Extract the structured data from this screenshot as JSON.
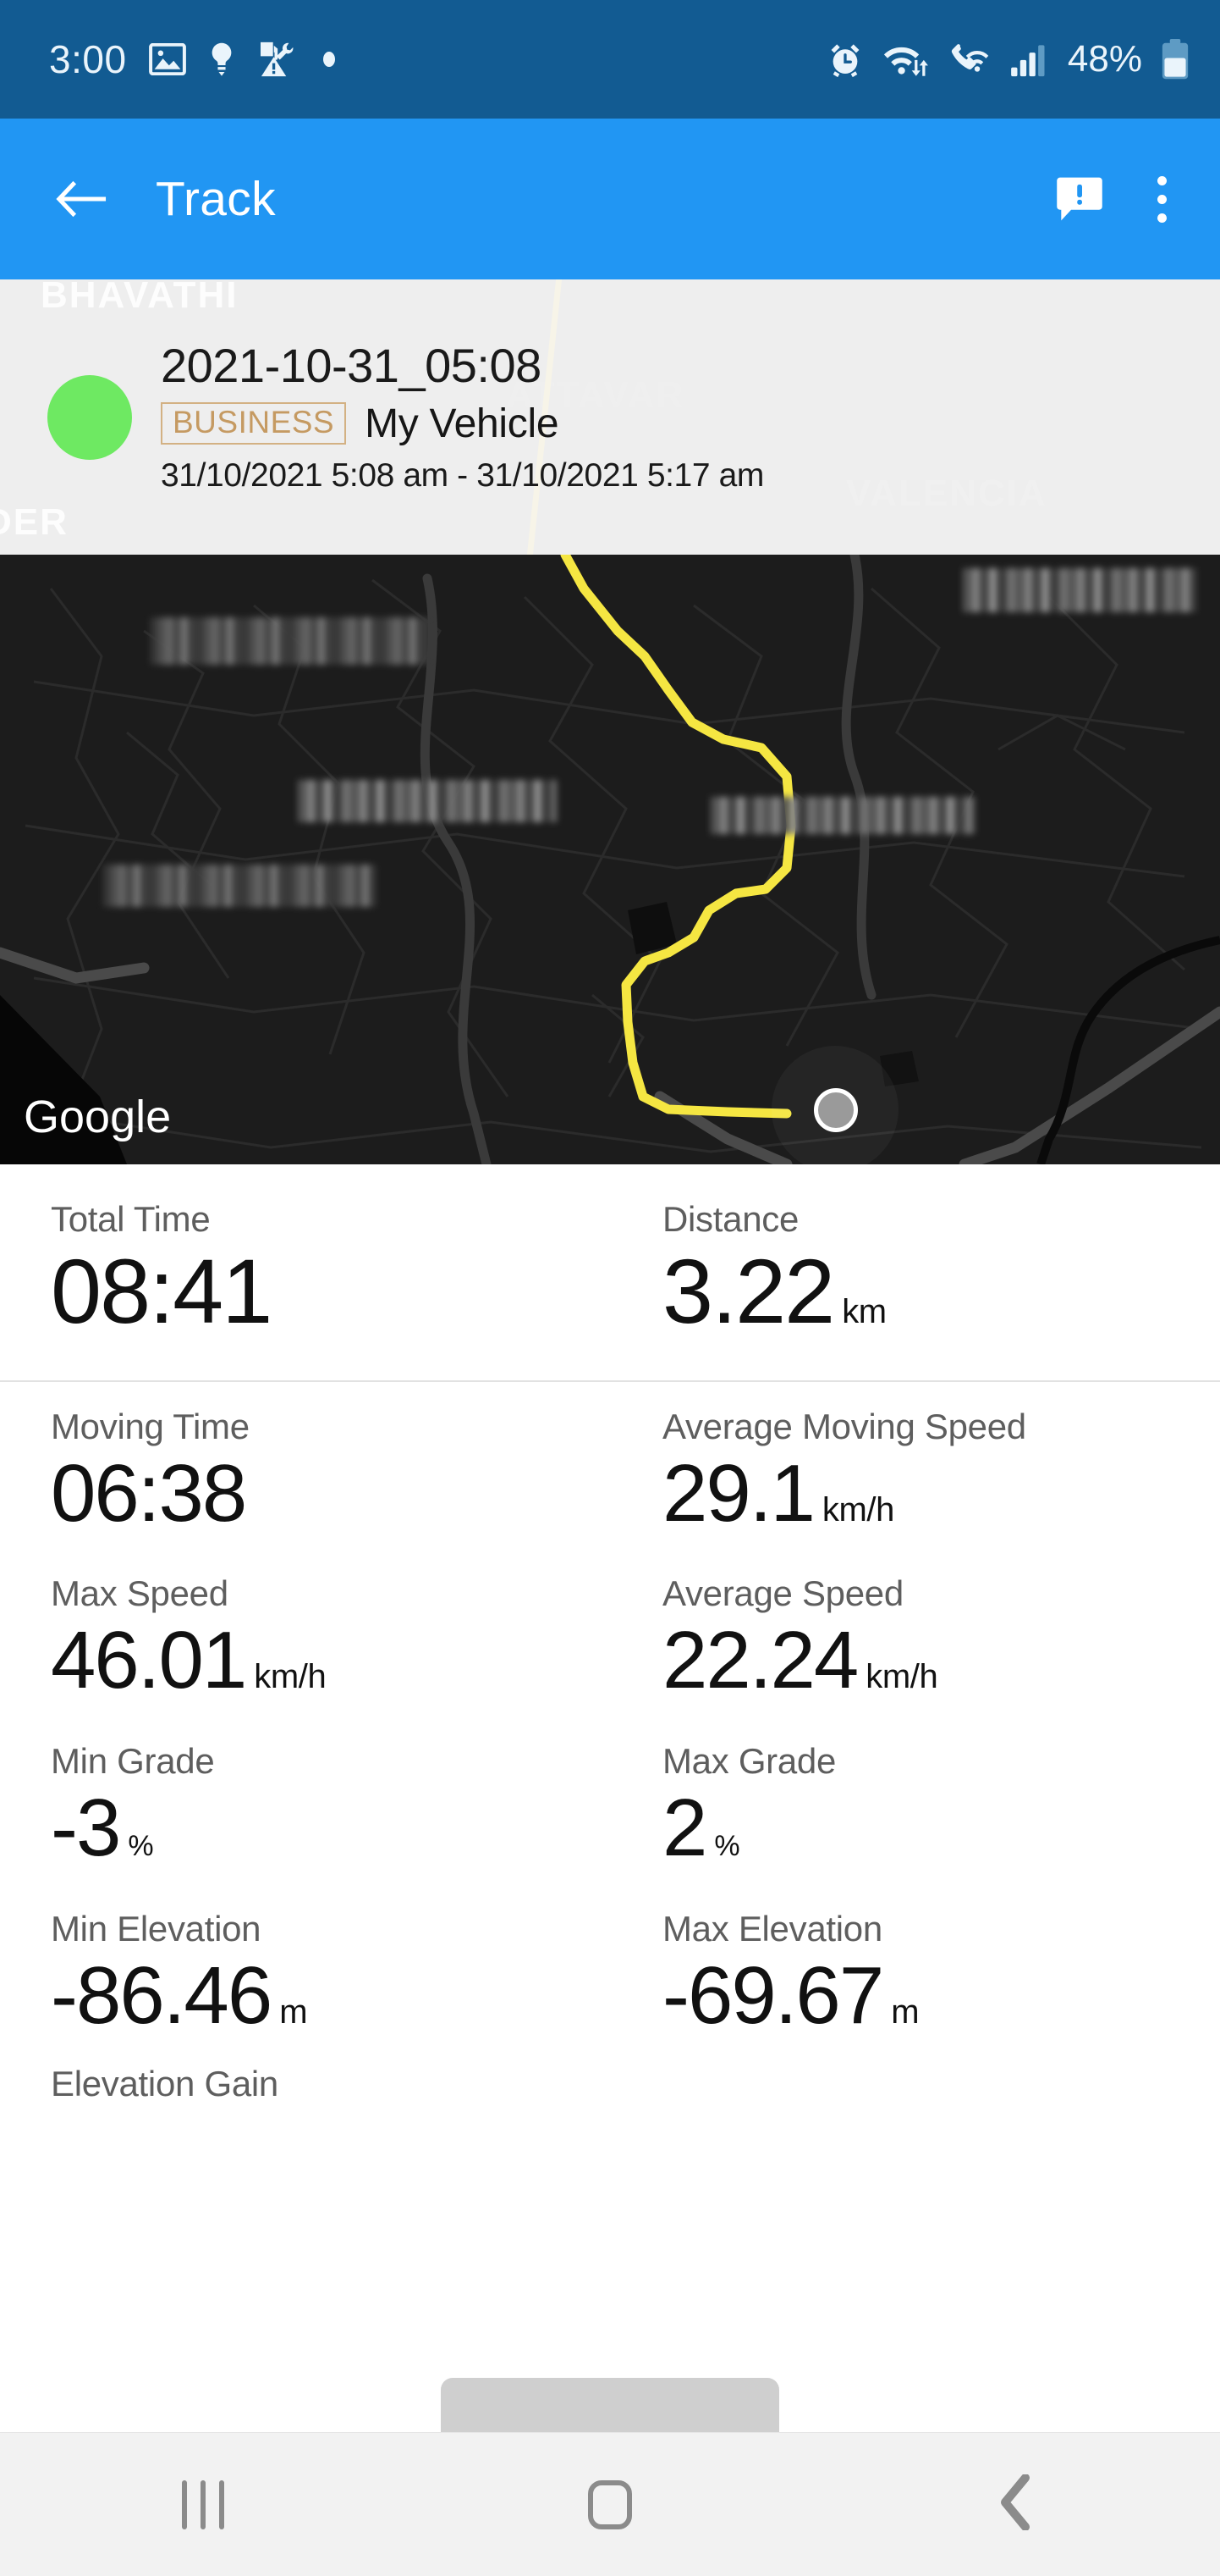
{
  "status_bar": {
    "clock": "3:00",
    "battery_percent": "48%",
    "left_icons": [
      "image-icon",
      "lightbulb-icon",
      "fuel-maintenance-icon",
      "dot-icon"
    ],
    "right_icons": [
      "alarm-icon",
      "wifi-data-icon",
      "wifi-calling-icon",
      "signal-bars-icon",
      "battery-icon"
    ],
    "bg_color": "#125b92"
  },
  "app_bar": {
    "title": "Track",
    "back_icon": "back-arrow-icon",
    "feedback_icon": "feedback-icon",
    "overflow_icon": "overflow-menu-icon",
    "bg_color": "#2196f3"
  },
  "track_header": {
    "marker_color": "#6ee962",
    "title": "2021-10-31_05:08",
    "badge": "BUSINESS",
    "badge_color": "#c59a62",
    "vehicle": "My Vehicle",
    "date_range": "31/10/2021 5:08 am - 31/10/2021 5:17 am",
    "ghost_labels": [
      "BHAVATHI",
      "DER",
      "ATTAVAR",
      "VALENCIA"
    ]
  },
  "map": {
    "attribution": "Google",
    "route_color": "#f5e642",
    "bg_color": "#1c1c1c",
    "redacted_labels": 4,
    "end_marker": "map-end-marker"
  },
  "stats": {
    "primary": [
      {
        "label": "Total Time",
        "value": "08:41",
        "unit": ""
      },
      {
        "label": "Distance",
        "value": "3.22",
        "unit": "km"
      }
    ],
    "rows": [
      [
        {
          "label": "Moving Time",
          "value": "06:38",
          "unit": ""
        },
        {
          "label": "Average Moving Speed",
          "value": "29.1",
          "unit": "km/h"
        }
      ],
      [
        {
          "label": "Max Speed",
          "value": "46.01",
          "unit": "km/h"
        },
        {
          "label": "Average Speed",
          "value": "22.24",
          "unit": "km/h"
        }
      ],
      [
        {
          "label": "Min Grade",
          "value": "-3",
          "unit": "%"
        },
        {
          "label": "Max Grade",
          "value": "2",
          "unit": "%"
        }
      ],
      [
        {
          "label": "Min Elevation",
          "value": "-86.46",
          "unit": "m"
        },
        {
          "label": "Max Elevation",
          "value": "-69.67",
          "unit": "m"
        }
      ]
    ],
    "partial_label": "Elevation Gain"
  },
  "nav_bar": {
    "recents": "recents-button",
    "home": "home-button",
    "back": "back-button"
  }
}
